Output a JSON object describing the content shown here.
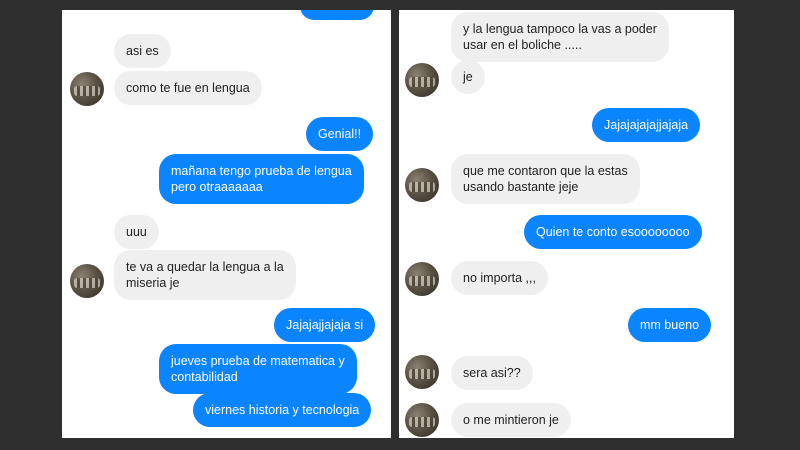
{
  "left_chat": {
    "messages": [
      {
        "text": "asi es"
      },
      {
        "text": "como te fue en lengua"
      },
      {
        "text": "Genial!!"
      },
      {
        "text": "mañana tengo prueba de lengua\npero otraaaaaaa"
      },
      {
        "text": "uuu"
      },
      {
        "text": "te va a quedar la lengua a la\nmiseria je"
      },
      {
        "text": "Jajajajjajaja si"
      },
      {
        "text": "jueves prueba de matematica y\ncontabilidad"
      },
      {
        "text": "viernes historia y tecnologia"
      }
    ]
  },
  "right_chat": {
    "messages": [
      {
        "text": "y la lengua tampoco la vas a poder\nusar en el boliche ....."
      },
      {
        "text": "je"
      },
      {
        "text": "Jajajajajajjajaja"
      },
      {
        "text": "que me contaron que la estas\nusando bastante jeje"
      },
      {
        "text": "Quien te conto esoooooooo"
      },
      {
        "text": "no importa ,,,"
      },
      {
        "text": "mm bueno"
      },
      {
        "text": "sera asi??"
      },
      {
        "text": "o me mintieron je"
      }
    ]
  },
  "colors": {
    "incoming_bubble": "#efefef",
    "outgoing_bubble": "#0a84ff",
    "background": "#2f2f2f"
  }
}
